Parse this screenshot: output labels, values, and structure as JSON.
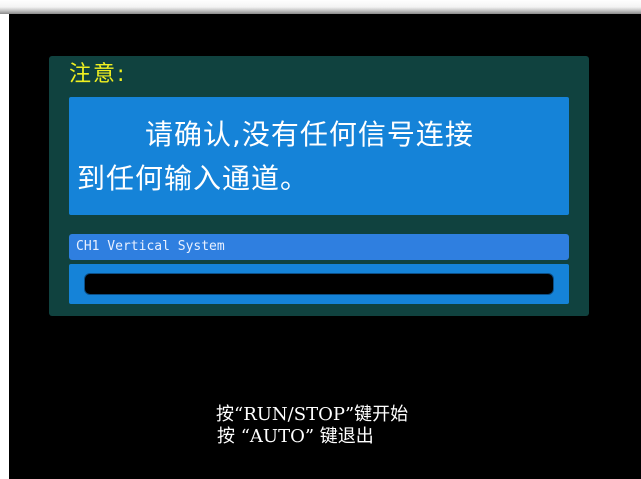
{
  "dialog": {
    "title": "注意:",
    "message_line1": "请确认,没有任何信号连接",
    "message_line2": "到任何输入通道。"
  },
  "progress": {
    "label": "CH1 Vertical System",
    "value": 0
  },
  "footer": {
    "hint_run_stop": "按“RUN/STOP”键开始",
    "hint_auto": "按 “AUTO” 键退出"
  },
  "colors": {
    "screen_bg": "#000000",
    "dialog_bg": "#10423f",
    "title": "#f0f020",
    "message_bg": "#1583d8",
    "label_bg": "#2f7fe0"
  }
}
